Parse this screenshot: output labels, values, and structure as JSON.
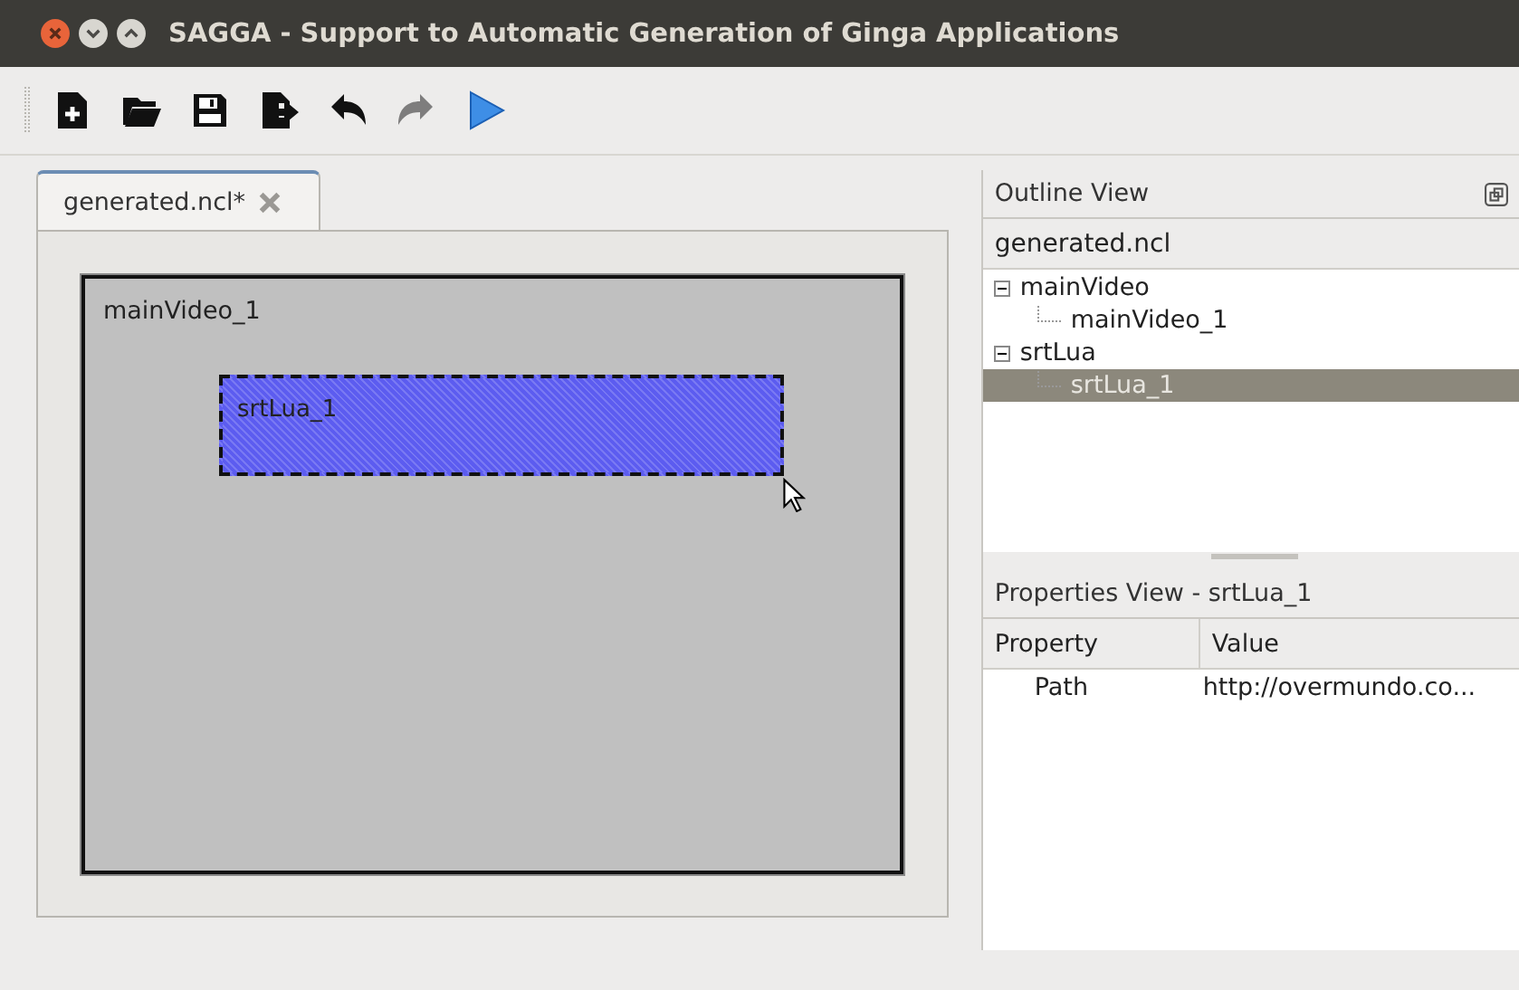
{
  "window": {
    "title": "SAGGA - Support to Automatic Generation of Ginga Applications"
  },
  "toolbar": [
    {
      "kind": "new",
      "disabled": false
    },
    {
      "kind": "open",
      "disabled": false
    },
    {
      "kind": "save",
      "disabled": false
    },
    {
      "kind": "export",
      "disabled": false
    },
    {
      "kind": "undo",
      "disabled": false
    },
    {
      "kind": "redo",
      "disabled": true
    },
    {
      "kind": "run",
      "disabled": false
    }
  ],
  "editor": {
    "tabs": [
      {
        "label": "generated.ncl*",
        "selected": true
      }
    ],
    "canvas": {
      "label": "mainVideo_1",
      "regions": [
        {
          "label": "srtLua_1",
          "selected": true
        }
      ]
    }
  },
  "outline": {
    "title": "Outline View",
    "root": "generated.ncl",
    "items": [
      {
        "label": "mainVideo",
        "expanded": true,
        "selected": false,
        "children": [
          {
            "label": "mainVideo_1",
            "selected": false
          }
        ]
      },
      {
        "label": "srtLua",
        "expanded": true,
        "selected": false,
        "children": [
          {
            "label": "srtLua_1",
            "selected": true
          }
        ]
      }
    ]
  },
  "properties": {
    "title": "Properties View - srtLua_1",
    "columns": [
      "Property",
      "Value"
    ],
    "rows": [
      {
        "property": "Path",
        "value": "http://overmundo.co..."
      }
    ]
  }
}
